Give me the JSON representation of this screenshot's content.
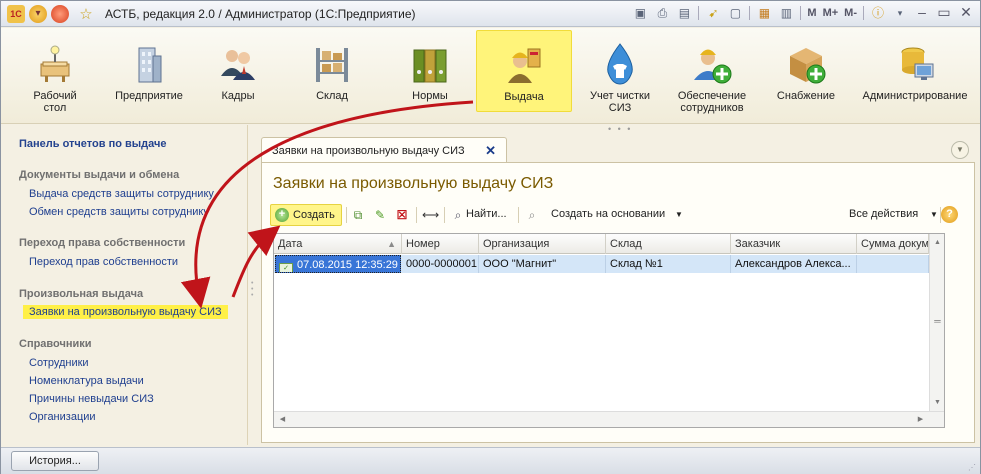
{
  "window": {
    "title": "АСТБ, редакция 2.0 / Администратор  (1С:Предприятие)",
    "logo": "1С",
    "toolbar_m_labels": [
      "M",
      "M+",
      "M-"
    ]
  },
  "sections": [
    {
      "label": "Рабочий стол",
      "icon": "desktop-icon",
      "active": false
    },
    {
      "label": "Предприятие",
      "icon": "building-icon",
      "active": false
    },
    {
      "label": "Кадры",
      "icon": "people-icon",
      "active": false
    },
    {
      "label": "Склад",
      "icon": "warehouse-icon",
      "active": false
    },
    {
      "label": "Нормы",
      "icon": "binders-icon",
      "active": false
    },
    {
      "label": "Выдача",
      "icon": "worker-icon",
      "active": true
    },
    {
      "label": "Учет чистки СИЗ",
      "icon": "drop-shirt-icon",
      "active": false
    },
    {
      "label": "Обеспечение сотрудников",
      "icon": "worker-add-icon",
      "active": false
    },
    {
      "label": "Снабжение",
      "icon": "box-add-icon",
      "active": false
    },
    {
      "label": "Администрирование",
      "icon": "admin-icon",
      "active": false
    }
  ],
  "left_panel": {
    "title": "Панель отчетов по выдаче",
    "groups": [
      {
        "title": "Документы выдачи и обмена",
        "items": [
          "Выдача средств защиты сотруднику",
          "Обмен средств защиты сотруднику"
        ]
      },
      {
        "title": "Переход права собственности",
        "items": [
          "Переход прав собственности"
        ]
      },
      {
        "title": "Произвольная выдача",
        "items": [
          "Заявки на произвольную выдачу СИЗ"
        ]
      },
      {
        "title": "Справочники",
        "items": [
          "Сотрудники",
          "Номенклатура выдачи",
          "Причины невыдачи СИЗ",
          "Организации"
        ]
      }
    ]
  },
  "tab": {
    "label": "Заявки на произвольную выдачу СИЗ"
  },
  "form": {
    "title": "Заявки на произвольную выдачу СИЗ",
    "toolbar": {
      "create": "Создать",
      "find": "Найти...",
      "create_based": "Создать на основании",
      "all_actions": "Все действия"
    },
    "table": {
      "columns": [
        "Дата",
        "Номер",
        "Организация",
        "Склад",
        "Заказчик",
        "Сумма докумен"
      ],
      "rows": [
        [
          "07.08.2015 12:35:29",
          "0000-0000001",
          "ООО \"Магнит\"",
          "Склад №1",
          "Александров Алекса...",
          ""
        ]
      ]
    }
  },
  "statusbar": {
    "history": "История..."
  },
  "colors": {
    "highlight": "#fff47a",
    "link": "#1f3f8f",
    "form_title": "#7a5a00",
    "annotation_arrow": "#c0141a"
  }
}
